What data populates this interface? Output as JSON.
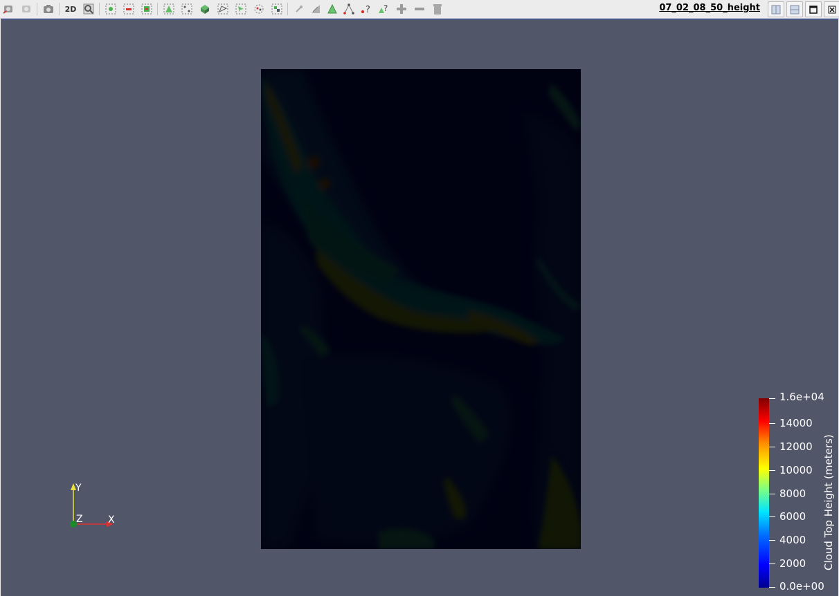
{
  "toolbar": {
    "mode_label": "2D",
    "icons": [
      "reset-camera-icon",
      "redo-icon",
      "screenshot-icon",
      "2d-mode-icon",
      "zoom-to-box-icon",
      "select-cells-icon",
      "deselect-icon",
      "grow-selection-icon",
      "select-points-icon",
      "select-frustum-icon",
      "select-block-icon",
      "select-polygon-icon",
      "interactive-select-icon",
      "hover-points-icon",
      "select-blocks-icon",
      "pick-center-icon",
      "ruler-icon",
      "triangle-icon",
      "edge-icon",
      "query-icon",
      "query-points-icon",
      "plus-icon",
      "minus-icon",
      "trash-icon"
    ]
  },
  "view": {
    "title": "07_02_08_50_height",
    "window_buttons": [
      "split-horizontal-icon",
      "split-vertical-icon",
      "maximize-icon",
      "close-icon"
    ]
  },
  "colorbar": {
    "title": "Cloud Top Height (meters)",
    "labels": [
      "1.6e+04",
      "14000",
      "12000",
      "10000",
      "8000",
      "6000",
      "4000",
      "2000",
      "0.0e+00"
    ],
    "colors": [
      "#00008f",
      "#0000ff",
      "#0070ff",
      "#00e5ff",
      "#7fff80",
      "#ffff00",
      "#ff9000",
      "#ff0000",
      "#800000"
    ]
  },
  "axes": {
    "x_label": "X",
    "y_label": "Y",
    "z_label": "Z"
  },
  "colors": {
    "background": "#525669",
    "active_border": "#3b5fd0"
  }
}
